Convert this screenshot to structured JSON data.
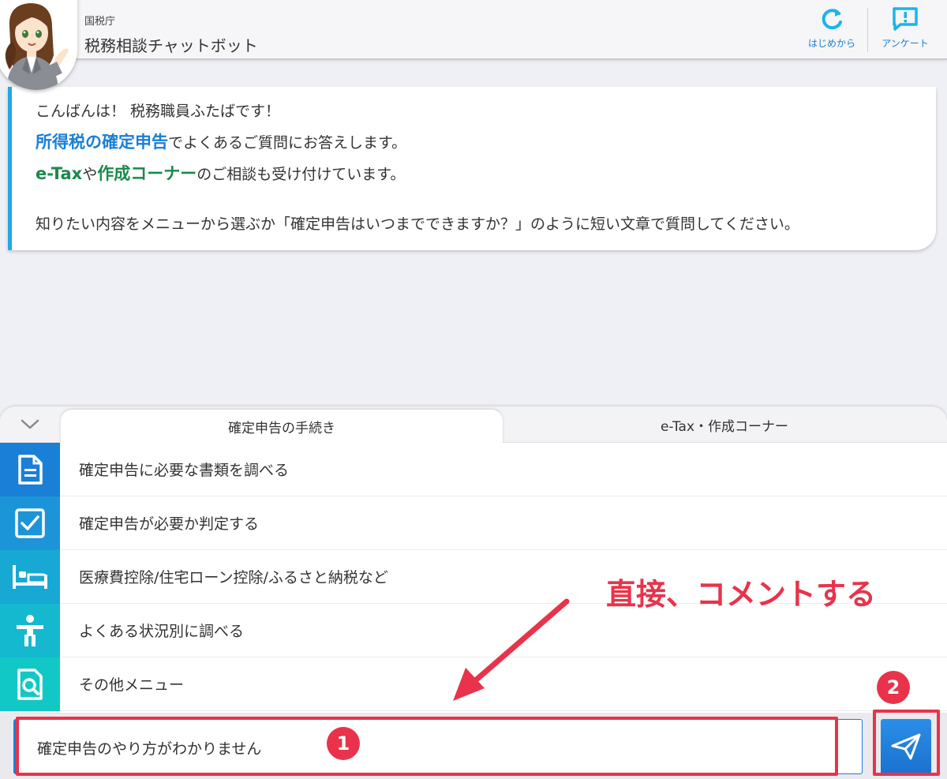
{
  "header": {
    "agency": "国税庁",
    "title": "税務相談チャットボット",
    "restart_label": "はじめから",
    "survey_label": "アンケート"
  },
  "message": {
    "line1": "こんばんは！ 税務職員ふたばです！",
    "line2_keyword": "所得税の確定申告",
    "line2_rest": "でよくあるご質問にお答えします。",
    "line3_kw1": "e-Tax",
    "line3_mid": "や",
    "line3_kw2": "作成コーナー",
    "line3_rest": "のご相談も受け付けています。",
    "line4": "知りたい内容をメニューから選ぶか「確定申告はいつまでできますか？」のように短い文章で質問してください。"
  },
  "tabs": {
    "active": "確定申告の手続き",
    "inactive": "e-Tax・作成コーナー"
  },
  "menu": [
    {
      "label": "確定申告に必要な書類を調べる",
      "icon": "document-icon",
      "color": "#1a7fd6"
    },
    {
      "label": "確定申告が必要か判定する",
      "icon": "checkbox-icon",
      "color": "#1c95d8"
    },
    {
      "label": "医療費控除/住宅ローン控除/ふるさと納税など",
      "icon": "bed-icon",
      "color": "#17a8d4"
    },
    {
      "label": "よくある状況別に調べる",
      "icon": "person-icon",
      "color": "#14b9cf"
    },
    {
      "label": "その他メニュー",
      "icon": "search-document-icon",
      "color": "#12c8c6"
    }
  ],
  "input": {
    "value": "確定申告のやり方がわかりません"
  },
  "annotations": {
    "badge1": "1",
    "badge2": "2",
    "caption": "直接、コメントする",
    "color": "#e8334a"
  },
  "colors": {
    "accent": "#1a7fd6",
    "keyword_green": "#1a8a4a",
    "bubble_border": "#21a9e1"
  }
}
